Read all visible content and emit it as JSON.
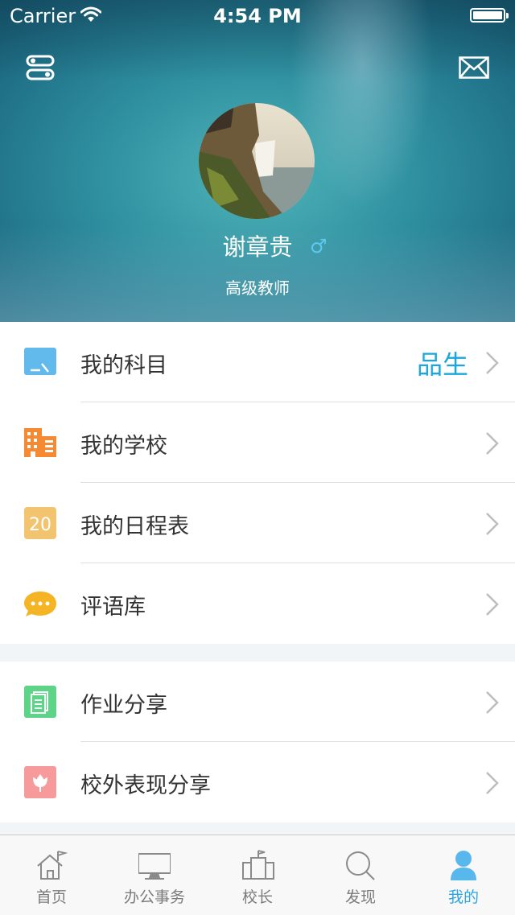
{
  "status_bar": {
    "carrier": "Carrier",
    "time": "4:54 PM",
    "battery_level": 1.0
  },
  "profile": {
    "name": "谢章贵",
    "gender_symbol": "♂",
    "title": "高级教师"
  },
  "menu_group_1": [
    {
      "label": "我的科目",
      "value": "品生",
      "icon": "subject-icon",
      "icon_color": "#62b9ec"
    },
    {
      "label": "我的学校",
      "icon": "school-building-icon",
      "icon_color": "#f58a33"
    },
    {
      "label": "我的日程表",
      "icon_text": "20",
      "icon": "calendar-icon",
      "icon_color": "#f2c46f"
    },
    {
      "label": "评语库",
      "icon": "comment-bubble-icon",
      "icon_color": "#f5b423"
    }
  ],
  "menu_group_2": [
    {
      "label": "作业分享",
      "icon": "homework-doc-icon",
      "icon_color": "#5dd487"
    },
    {
      "label": "校外表现分享",
      "icon": "flower-icon",
      "icon_color": "#f79a9c"
    }
  ],
  "tabbar": [
    {
      "label": "首页",
      "icon": "home-icon",
      "active": false
    },
    {
      "label": "办公事务",
      "icon": "monitor-icon",
      "active": false
    },
    {
      "label": "校长",
      "icon": "principal-building-icon",
      "active": false
    },
    {
      "label": "发现",
      "icon": "search-icon",
      "active": false
    },
    {
      "label": "我的",
      "icon": "person-icon",
      "active": true
    }
  ],
  "colors": {
    "accent": "#2ba6e4",
    "value_text": "#1ba6e0",
    "inactive_tab": "#7b7b7b"
  }
}
